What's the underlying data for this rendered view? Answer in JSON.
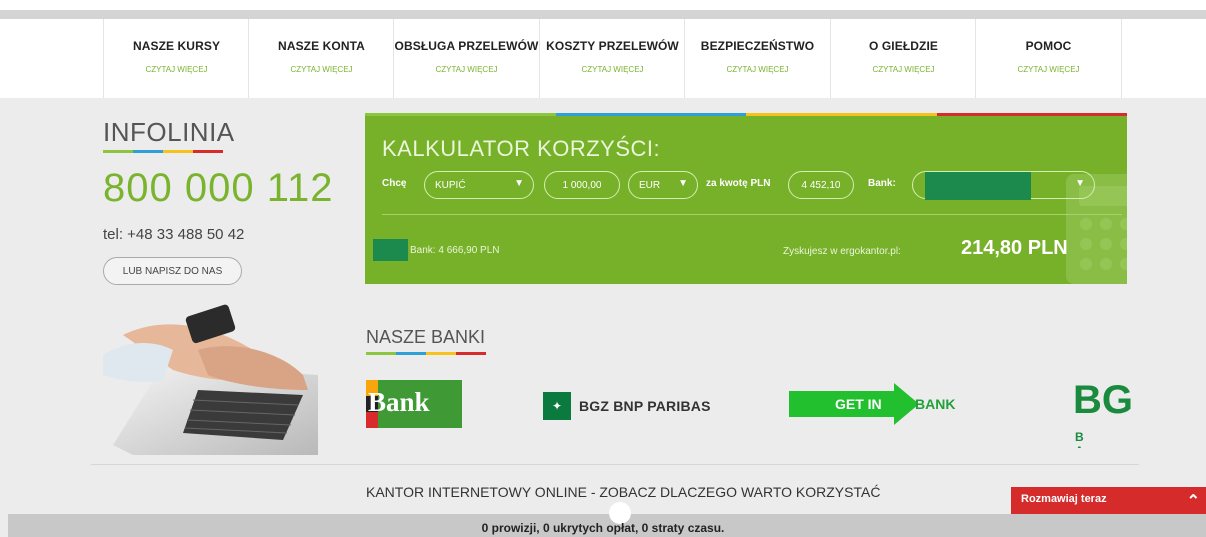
{
  "nav": {
    "items": [
      {
        "title": "NASZE KURSY",
        "sub": "CZYTAJ WIĘCEJ"
      },
      {
        "title": "NASZE KONTA",
        "sub": "CZYTAJ WIĘCEJ"
      },
      {
        "title": "OBSŁUGA PRZELEWÓW",
        "sub": "CZYTAJ WIĘCEJ"
      },
      {
        "title": "KOSZTY PRZELEWÓW",
        "sub": "CZYTAJ WIĘCEJ"
      },
      {
        "title": "BEZPIECZEŃSTWO",
        "sub": "CZYTAJ WIĘCEJ"
      },
      {
        "title": "O GIEŁDZIE",
        "sub": "CZYTAJ WIĘCEJ"
      },
      {
        "title": "POMOC",
        "sub": "CZYTAJ WIĘCEJ"
      }
    ]
  },
  "info": {
    "title": "INFOLINIA",
    "phone": "800 000 112",
    "tel": "tel: +48 33 488 50 42",
    "write_btn": "LUB NAPISZ DO NAS"
  },
  "calc": {
    "title": "KALKULATOR KORZYŚCI:",
    "want_label": "Chcę",
    "action": "KUPIĆ",
    "amount": "1 000,00",
    "currency": "EUR",
    "pln_label": "za kwotę PLN",
    "pln_amount": "4 452,10",
    "bank_label": "Bank:",
    "bank_result": "Bank: 4 666,90 PLN",
    "gain_label": "Zyskujesz w ergokantor.pl:",
    "gain": "214,80 PLN"
  },
  "banks": {
    "title": "NASZE BANKI",
    "logos": [
      {
        "text": "Bank"
      },
      {
        "text": "BGZ BNP PARIBAS"
      },
      {
        "text1": "GET IN",
        "text2": "BANK"
      },
      {
        "text1": "BG",
        "text2": "B A"
      }
    ]
  },
  "footer": {
    "kantor": "KANTOR INTERNETOWY ONLINE - ZOBACZ DLACZEGO WARTO KORZYSTAĆ",
    "tagline": "0 prowizji, 0 ukrytych opłat, 0 straty czasu.",
    "chat": "Rozmawiaj teraz"
  },
  "colors": {
    "accent_green": "#7ab32e",
    "calc_bg": "#77b12a",
    "rainbow": [
      "#8cc63f",
      "#2f9fd8",
      "#f7c21c",
      "#d82b2b"
    ],
    "chat_red": "#d62b2b"
  }
}
